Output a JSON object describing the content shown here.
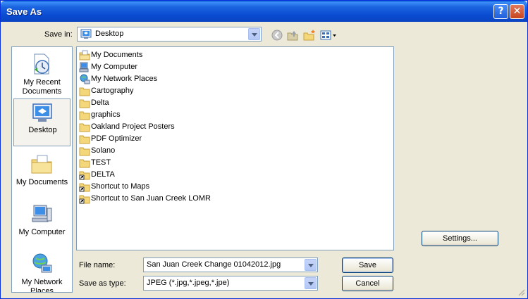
{
  "window": {
    "title": "Save As"
  },
  "titlebar": {
    "help_glyph": "?",
    "close_glyph": "✕"
  },
  "save_in": {
    "label": "Save in:",
    "value": "Desktop",
    "icon": "desktop-icon"
  },
  "toolbar": {
    "icons": [
      "back-icon",
      "up-folder-icon",
      "new-folder-icon",
      "views-icon"
    ]
  },
  "places": [
    {
      "label": "My Recent Documents",
      "icon": "recent-documents-icon"
    },
    {
      "label": "Desktop",
      "icon": "desktop-icon",
      "selected": true
    },
    {
      "label": "My Documents",
      "icon": "my-documents-icon"
    },
    {
      "label": "My Computer",
      "icon": "my-computer-icon"
    },
    {
      "label": "My Network Places",
      "icon": "network-places-icon"
    }
  ],
  "files": [
    {
      "name": "My Documents",
      "icon": "my-documents-icon"
    },
    {
      "name": "My Computer",
      "icon": "my-computer-icon"
    },
    {
      "name": "My Network Places",
      "icon": "network-places-icon"
    },
    {
      "name": "Cartography",
      "icon": "folder-icon"
    },
    {
      "name": "Delta",
      "icon": "folder-icon"
    },
    {
      "name": "graphics",
      "icon": "folder-icon"
    },
    {
      "name": "Oakland Project Posters",
      "icon": "folder-icon"
    },
    {
      "name": "PDF Optimizer",
      "icon": "folder-icon"
    },
    {
      "name": "Solano",
      "icon": "folder-icon"
    },
    {
      "name": "TEST",
      "icon": "folder-icon"
    },
    {
      "name": "DELTA",
      "icon": "folder-shortcut-icon"
    },
    {
      "name": "Shortcut to Maps",
      "icon": "folder-shortcut-icon"
    },
    {
      "name": "Shortcut to San Juan Creek LOMR",
      "icon": "folder-shortcut-icon"
    }
  ],
  "file_name": {
    "label": "File name:",
    "value": "San Juan Creek Change 01042012.jpg"
  },
  "save_as_type": {
    "label": "Save as type:",
    "value": "JPEG (*.jpg,*.jpeg,*.jpe)"
  },
  "buttons": {
    "save": "Save",
    "cancel": "Cancel",
    "settings": "Settings..."
  },
  "colors": {
    "titlebar": "#0a4bd1",
    "dialog_bg": "#ece9d8",
    "border": "#7f9db9",
    "folder": "#f3d77a"
  }
}
